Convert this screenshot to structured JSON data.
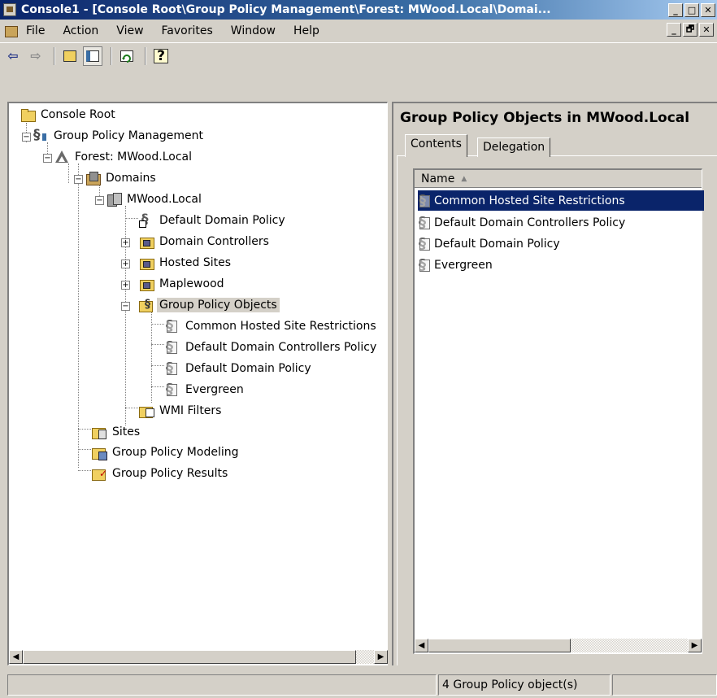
{
  "window": {
    "title": "Console1 - [Console Root\\Group Policy Management\\Forest: MWood.Local\\Domai...",
    "caption_buttons": [
      "_",
      "□",
      "✕"
    ],
    "mdi_buttons": [
      "_",
      "🗗",
      "✕"
    ]
  },
  "menu": {
    "items": [
      "File",
      "Action",
      "View",
      "Favorites",
      "Window",
      "Help"
    ]
  },
  "toolbar": {
    "buttons": [
      {
        "icon": "back-arrow-icon",
        "glyph": "⇦"
      },
      {
        "icon": "forward-arrow-icon",
        "glyph": "⇨"
      },
      {
        "icon": "up-folder-icon"
      },
      {
        "icon": "show-hide-tree-icon"
      },
      {
        "icon": "refresh-icon"
      },
      {
        "icon": "help-icon",
        "glyph": "?"
      }
    ]
  },
  "tree": {
    "nodes": [
      {
        "label": "Console Root",
        "icon": "folder"
      },
      {
        "label": "Group Policy Management",
        "icon": "gpm"
      },
      {
        "label": "Forest: MWood.Local",
        "icon": "forest"
      },
      {
        "label": "Domains",
        "icon": "domains"
      },
      {
        "label": "MWood.Local",
        "icon": "domain"
      },
      {
        "label": "Default Domain Policy",
        "icon": "link"
      },
      {
        "label": "Domain Controllers",
        "icon": "ou"
      },
      {
        "label": "Hosted Sites",
        "icon": "ou"
      },
      {
        "label": "Maplewood",
        "icon": "ou"
      },
      {
        "label": "Group Policy Objects",
        "icon": "gpofolder",
        "selected": true
      },
      {
        "label": "Common Hosted Site Restrictions",
        "icon": "gpo"
      },
      {
        "label": "Default Domain Controllers Policy",
        "icon": "gpo"
      },
      {
        "label": "Default Domain Policy",
        "icon": "gpo"
      },
      {
        "label": "Evergreen",
        "icon": "gpo"
      },
      {
        "label": "WMI Filters",
        "icon": "wmi"
      },
      {
        "label": "Sites",
        "icon": "sites"
      },
      {
        "label": "Group Policy Modeling",
        "icon": "modeling"
      },
      {
        "label": "Group Policy Results",
        "icon": "results"
      }
    ],
    "expander_symbols": {
      "expanded": "−",
      "collapsed": "+"
    }
  },
  "details": {
    "header": "Group Policy Objects in MWood.Local",
    "tabs": [
      "Contents",
      "Delegation"
    ],
    "active_tab": "Contents",
    "column": "Name",
    "sort_indicator": "▲",
    "items": [
      {
        "label": "Common Hosted Site Restrictions",
        "selected": true
      },
      {
        "label": "Default Domain Controllers Policy"
      },
      {
        "label": "Default Domain Policy"
      },
      {
        "label": "Evergreen"
      }
    ]
  },
  "scroll_arrows": {
    "left": "◀",
    "right": "▶"
  },
  "status": {
    "message": "4 Group Policy object(s)"
  }
}
